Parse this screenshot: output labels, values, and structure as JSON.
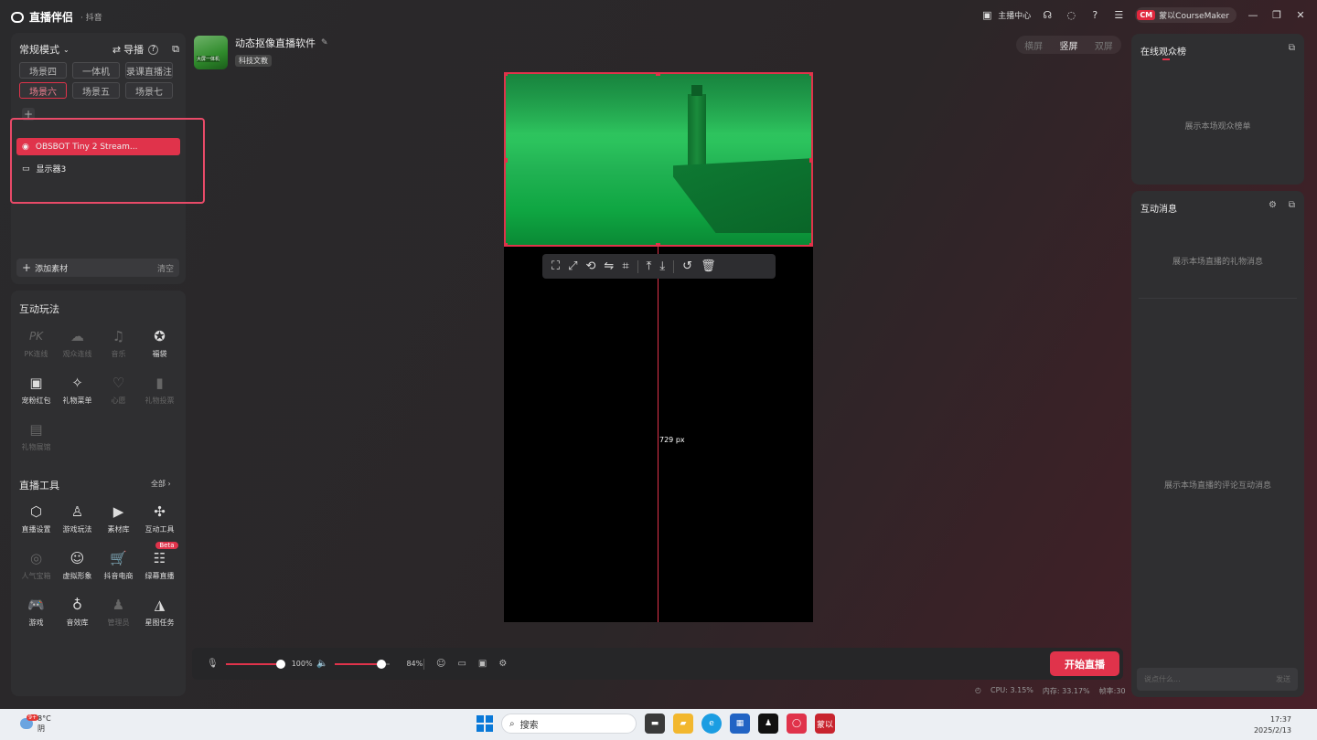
{
  "app": {
    "name": "直播伴侣",
    "platform": "· 抖音",
    "creator_center": "主播中心",
    "account_badge": "CM",
    "account_name": "蒙以CourseMaker"
  },
  "left": {
    "mode": "常规模式",
    "guide": "导播",
    "scenes": [
      "场景四",
      "一体机",
      "录课直播注",
      "场景六",
      "场景五",
      "场景七"
    ],
    "active_scene": "场景六",
    "sources": [
      {
        "label": "OBSBOT Tiny 2 Stream...",
        "icon": "webcam-icon",
        "active": true
      },
      {
        "label": "显示器3",
        "icon": "monitor-icon",
        "active": false
      }
    ],
    "add_material": "添加素材",
    "clear": "清空",
    "interactive_title": "互动玩法",
    "interactive": [
      {
        "label": "PK连线",
        "glyph": "PK",
        "enabled": false
      },
      {
        "label": "观众连线",
        "glyph": "☁",
        "enabled": false
      },
      {
        "label": "音乐",
        "glyph": "♫",
        "enabled": false
      },
      {
        "label": "福袋",
        "glyph": "✪",
        "enabled": true
      },
      {
        "label": "宠粉红包",
        "glyph": "▣",
        "enabled": true
      },
      {
        "label": "礼物菜单",
        "glyph": "✧",
        "enabled": true
      },
      {
        "label": "心愿",
        "glyph": "♡",
        "enabled": false
      },
      {
        "label": "礼物投票",
        "glyph": "▮",
        "enabled": false
      },
      {
        "label": "礼物展馆",
        "glyph": "▤",
        "enabled": false
      }
    ],
    "tools_title": "直播工具",
    "tools_all": "全部 ›",
    "tools": [
      {
        "label": "直播设置",
        "glyph": "⬡",
        "enabled": true
      },
      {
        "label": "游戏玩法",
        "glyph": "♙",
        "enabled": true
      },
      {
        "label": "素材库",
        "glyph": "▶",
        "enabled": true
      },
      {
        "label": "互动工具",
        "glyph": "✣",
        "enabled": true
      },
      {
        "label": "人气宝箱",
        "glyph": "◎",
        "enabled": false
      },
      {
        "label": "虚拟形象",
        "glyph": "☺",
        "enabled": true
      },
      {
        "label": "抖音电商",
        "glyph": "🛒",
        "enabled": true
      },
      {
        "label": "绿幕直播",
        "glyph": "☷",
        "enabled": true,
        "badge": "Beta"
      },
      {
        "label": "游戏",
        "glyph": "🎮",
        "enabled": true
      },
      {
        "label": "音效库",
        "glyph": "♁",
        "enabled": true
      },
      {
        "label": "管理员",
        "glyph": "♟",
        "enabled": false
      },
      {
        "label": "星图任务",
        "glyph": "◮",
        "enabled": true
      }
    ]
  },
  "center": {
    "stream_title": "动态抠像直播软件",
    "thumb_text": "大屏一体机",
    "category": "科技文教",
    "orientation": [
      "横屏",
      "竖屏",
      "双屏"
    ],
    "active_orientation": "竖屏",
    "guide_measure": "729 px"
  },
  "controls": {
    "mic_volume": 100,
    "mic_volume_label": "100%",
    "speaker_volume": 84,
    "speaker_volume_label": "84%",
    "start_button": "开始直播",
    "cpu": "CPU: 3.15%",
    "memory": "内存: 33.17%",
    "fps": "帧率:30"
  },
  "right": {
    "audience_title": "在线观众榜",
    "audience_empty": "展示本场观众榜单",
    "messages_title": "互动消息",
    "gift_empty": "展示本场直播的礼物消息",
    "comment_empty": "展示本场直播的评论互动消息",
    "input_placeholder": "说点什么...",
    "send": "发送"
  },
  "taskbar": {
    "weather_badge": "9+",
    "temperature": "8°C",
    "condition": "阴",
    "search": "搜索",
    "time": "17:37",
    "date": "2025/2/13",
    "app_label": "蒙以"
  },
  "colors": {
    "accent": "#e0334b",
    "panel": "#2f2f31",
    "green_screen": "#2fc860"
  }
}
